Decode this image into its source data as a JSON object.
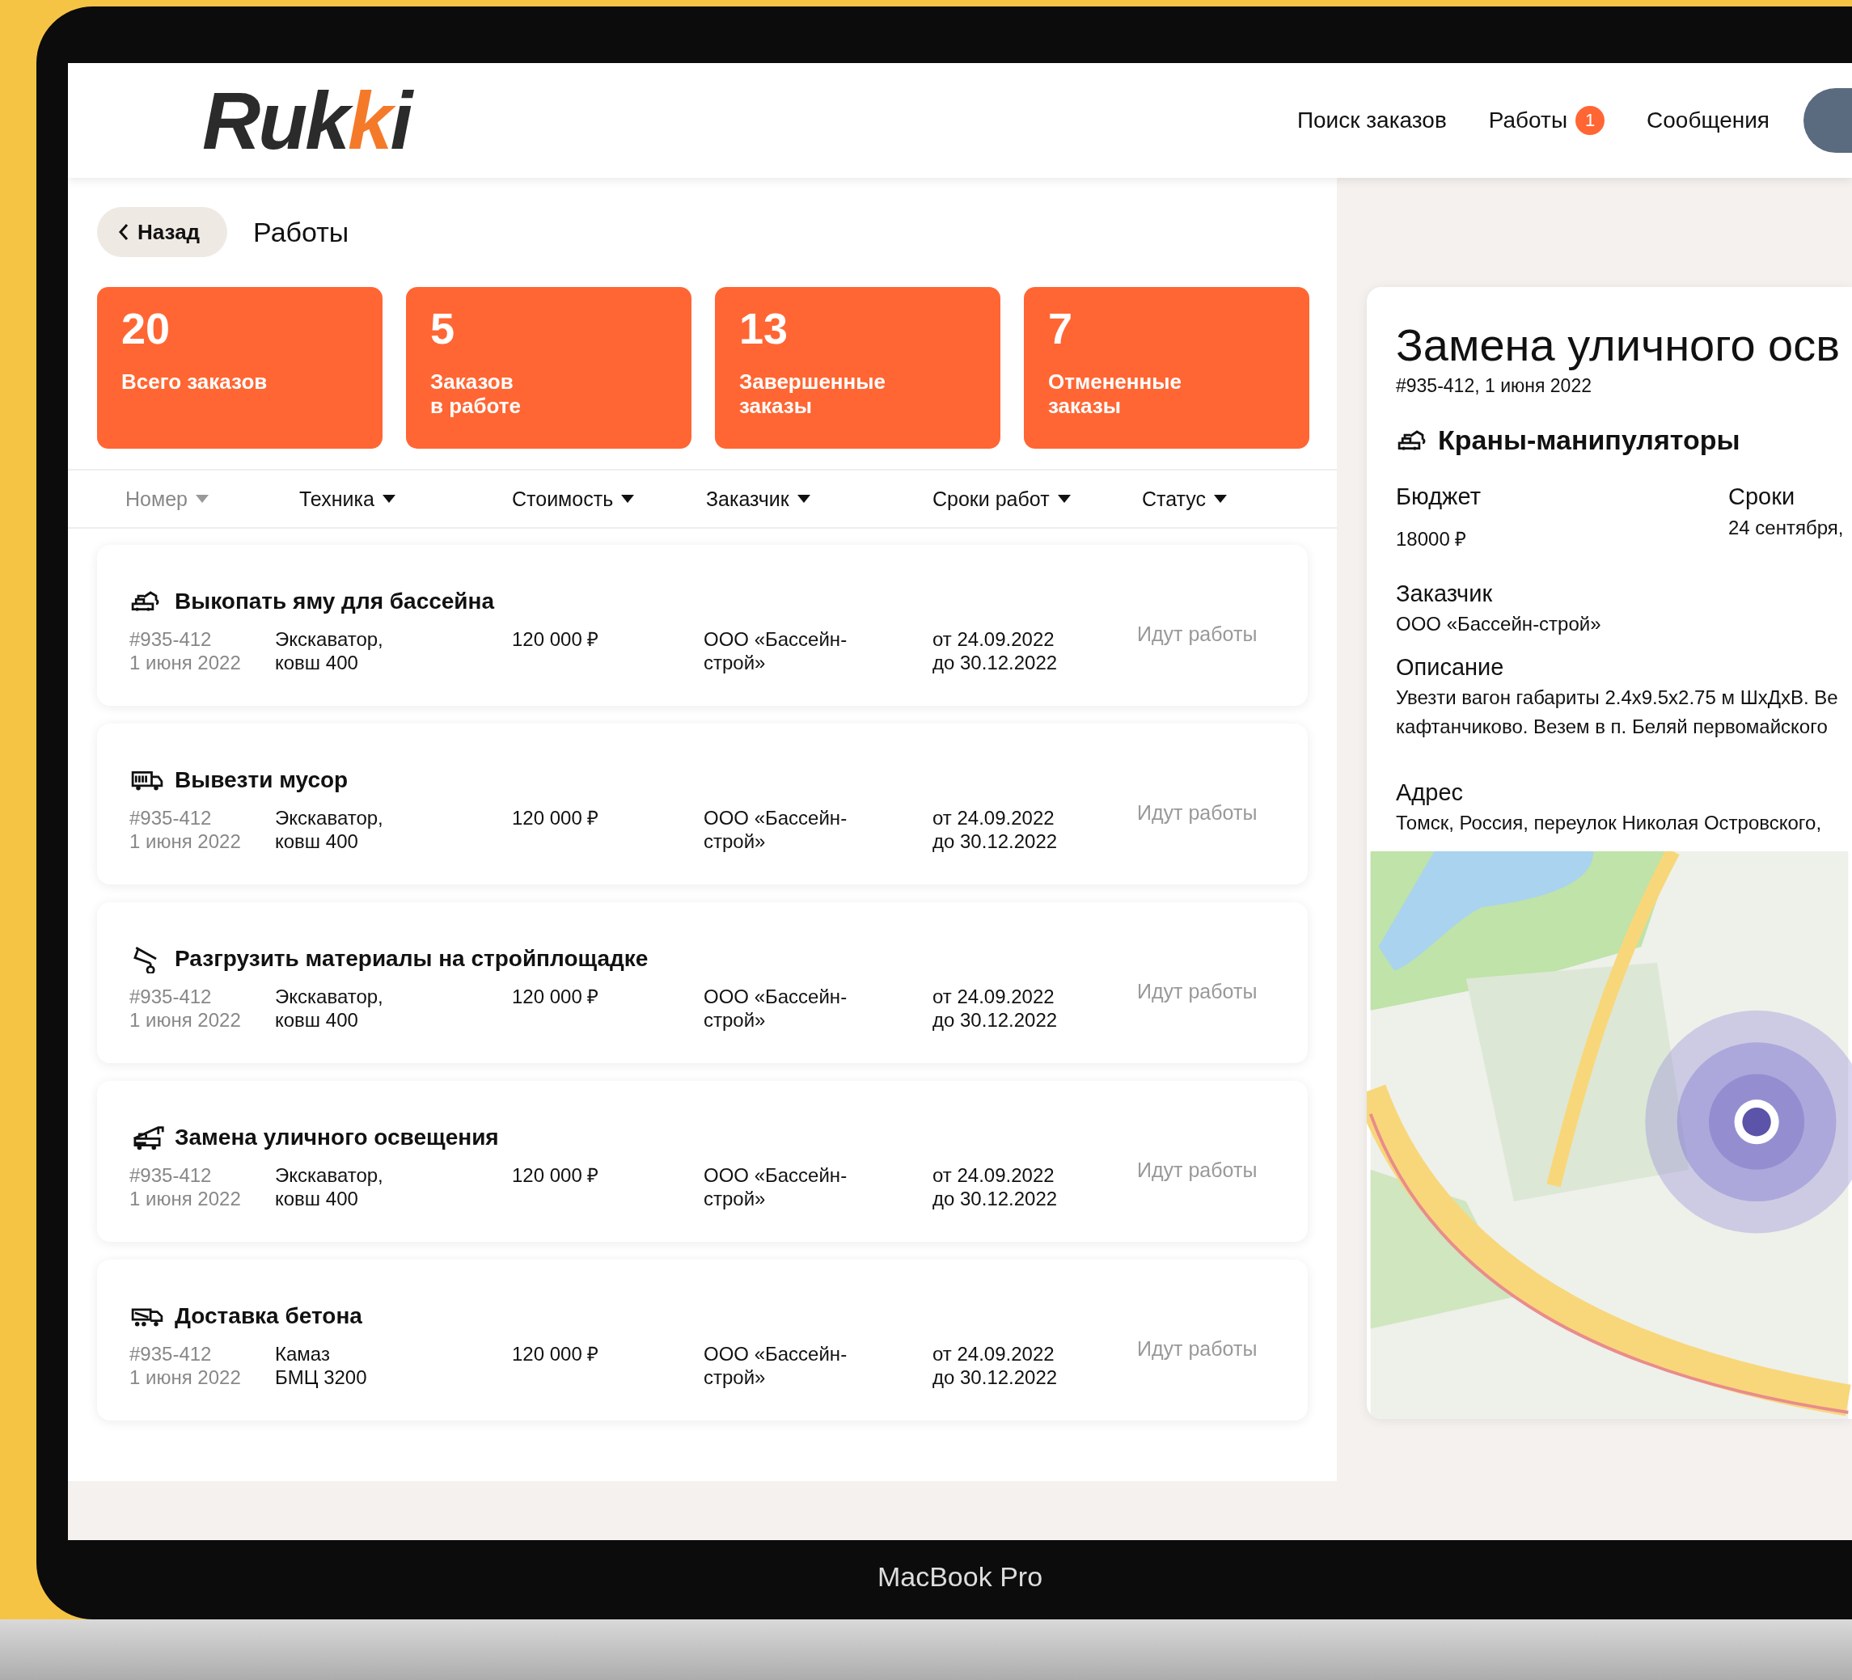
{
  "header": {
    "logo": "Rukki",
    "nav": [
      {
        "label": "Поиск заказов"
      },
      {
        "label": "Работы",
        "badge": "1"
      },
      {
        "label": "Сообщения"
      }
    ]
  },
  "page": {
    "back": "Назад",
    "title": "Работы"
  },
  "stats": [
    {
      "value": "20",
      "label": "Всего заказов"
    },
    {
      "value": "5",
      "label": "Заказов в работе"
    },
    {
      "value": "13",
      "label": "Завершенные заказы"
    },
    {
      "value": "7",
      "label": "Отмененные заказы"
    }
  ],
  "filters": [
    {
      "label": "Номер",
      "dimmed": true
    },
    {
      "label": "Техника",
      "dimmed": false
    },
    {
      "label": "Стоимость",
      "dimmed": false
    },
    {
      "label": "Заказчик",
      "dimmed": false
    },
    {
      "label": "Сроки работ",
      "dimmed": false
    },
    {
      "label": "Статус",
      "dimmed": false
    }
  ],
  "orders": [
    {
      "kind": "excavator",
      "title": "Выкопать яму для бассейна",
      "number": "#935-412",
      "date": "1 июня 2022",
      "machine": "Экскаватор, ковш 400",
      "cost": "120 000 ₽",
      "customer": "ООО «Бассейн-строй»",
      "from": "от 24.09.2022",
      "to": "до 30.12.2022",
      "status": "Идут работы"
    },
    {
      "kind": "garbage-truck",
      "title": "Вывезти мусор",
      "number": "#935-412",
      "date": "1 июня 2022",
      "machine": "Экскаватор, ковш 400",
      "cost": "120 000 ₽",
      "customer": "ООО «Бассейн-строй»",
      "from": "от 24.09.2022",
      "to": "до 30.12.2022",
      "status": "Идут работы"
    },
    {
      "kind": "hook",
      "title": "Разгрузить материалы на стройплощадке",
      "number": "#935-412",
      "date": "1 июня 2022",
      "machine": "Экскаватор, ковш 400",
      "cost": "120 000 ₽",
      "customer": "ООО «Бассейн-строй»",
      "from": "от 24.09.2022",
      "to": "до 30.12.2022",
      "status": "Идут работы"
    },
    {
      "kind": "crane-truck",
      "title": "Замена уличного освещения",
      "number": "#935-412",
      "date": "1 июня 2022",
      "machine": "Экскаватор, ковш 400",
      "cost": "120 000 ₽",
      "customer": "ООО «Бассейн-строй»",
      "from": "от 24.09.2022",
      "to": "до 30.12.2022",
      "status": "Идут работы"
    },
    {
      "kind": "mixer-truck",
      "title": "Доставка бетона",
      "number": "#935-412",
      "date": "1 июня 2022",
      "machine": "Камаз БМЦ 3200",
      "cost": "120 000 ₽",
      "customer": "ООО «Бассейн-строй»",
      "from": "от 24.09.2022",
      "to": "до 30.12.2022",
      "status": "Идут работы"
    }
  ],
  "detail": {
    "title": "Замена уличного осв",
    "meta": "#935-412, 1 июня 2022",
    "category": "Краны-манипуляторы",
    "budget_label": "Бюджет",
    "budget": "18000 ₽",
    "terms_label": "Сроки",
    "terms": "24 сентября,",
    "customer_label": "Заказчик",
    "customer": "ООО «Бассейн-строй»",
    "description_label": "Описание",
    "description": [
      "Увезти вагон габариты 2.4x9.5x2.75 м ШхДхВ. Ве",
      "кафтанчиково. Везем в п. Беляй первомайского"
    ],
    "address_label": "Адрес",
    "address": "Томск, Россия, переулок Николая Островского,"
  },
  "device_label": "MacBook Pro"
}
